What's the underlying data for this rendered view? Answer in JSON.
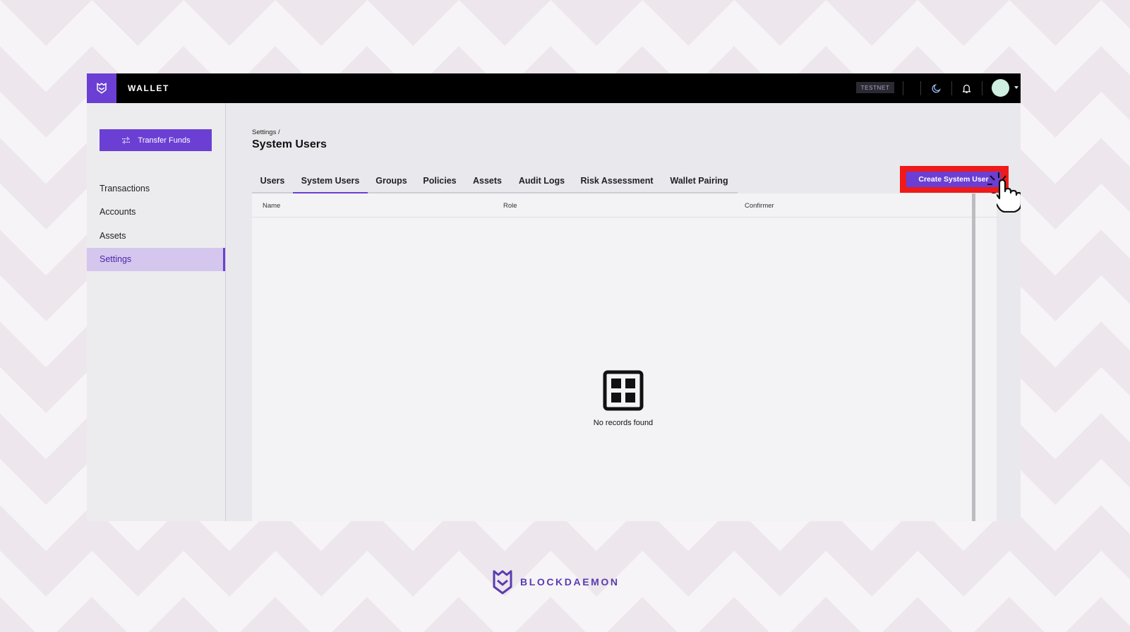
{
  "topbar": {
    "app_name": "WALLET",
    "network_badge": "TESTNET",
    "icons": [
      "blockdaemon-logo-icon",
      "moon-icon",
      "bell-icon",
      "chevron-down-icon"
    ]
  },
  "sidebar": {
    "transfer_button": "Transfer Funds",
    "items": [
      {
        "label": "Transactions",
        "active": false
      },
      {
        "label": "Accounts",
        "active": false
      },
      {
        "label": "Assets",
        "active": false
      },
      {
        "label": "Settings",
        "active": true
      }
    ]
  },
  "page": {
    "breadcrumb": "Settings /",
    "title": "System Users",
    "tabs": [
      {
        "label": "Users",
        "active": false
      },
      {
        "label": "System Users",
        "active": true
      },
      {
        "label": "Groups",
        "active": false
      },
      {
        "label": "Policies",
        "active": false
      },
      {
        "label": "Assets",
        "active": false
      },
      {
        "label": "Audit Logs",
        "active": false
      },
      {
        "label": "Risk Assessment",
        "active": false
      },
      {
        "label": "Wallet Pairing",
        "active": false
      }
    ],
    "create_button": "Create System User",
    "table": {
      "columns": [
        "Name",
        "Role",
        "Confirmer"
      ],
      "rows": [],
      "empty_text": "No records found"
    }
  },
  "footer": {
    "brand": "BLOCKDAEMON"
  },
  "colors": {
    "accent": "#6b3fd4",
    "active_nav_bg": "#d4c6ed",
    "highlight": "#ef1a1a",
    "topbar": "#000000"
  }
}
